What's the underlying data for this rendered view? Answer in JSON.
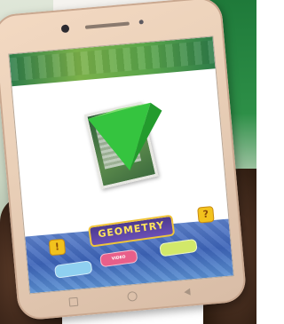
{
  "app": {
    "title": "GEOMETRY",
    "subtitle": "",
    "buttons": {
      "video": "VIDEO",
      "left": "",
      "right": ""
    },
    "badges": {
      "info": "!",
      "help": "?"
    }
  },
  "scene": {
    "ar_object": "green-pyramid",
    "icons": [
      "camera-icon",
      "speaker-icon",
      "home-key-icon",
      "back-key-icon",
      "recent-apps-key-icon"
    ]
  },
  "colors": {
    "pyramid": "#35c43f",
    "title_text": "#ffe45c",
    "title_border": "#f0c43a",
    "button_video": "#e85f8a",
    "button_left": "#8fd0f0",
    "button_right": "#d2e86a",
    "bottom_panel": "#4b73c2",
    "header_strip": "#5aa54a"
  }
}
